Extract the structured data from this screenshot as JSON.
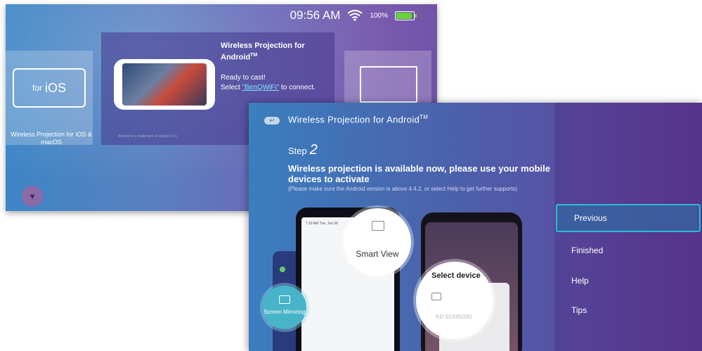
{
  "back_screen": {
    "status": {
      "time": "09:56 AM",
      "battery": "100%"
    },
    "ios_card": {
      "box_for": "for",
      "box_ios": "iOS",
      "label": "Wireless Projection for iOS & macOS"
    },
    "android_card": {
      "title": "Wireless Projection for Android",
      "tm": "TM",
      "ready": "Ready to cast!",
      "select_prefix": "Select ",
      "network": "\"BenQWiFi\"",
      "select_suffix": " to connect.",
      "trademark": "Android is a trademark of Google LLC."
    }
  },
  "front_screen": {
    "title": "Wireless Projection for Android",
    "tm": "TM",
    "step_label": "Step",
    "step_number": "2",
    "description": "Wireless projection is available now, please use your mobile devices to activate",
    "note": "(Please make sure the Android version is above 4.4.2, or select Help to get further supports)",
    "left_phone_clock": "7:18 AM   Tue, Jun 06",
    "smart_view": "Smart View",
    "screen_mirroring": "Screen Mirroring",
    "select_device": "Select device",
    "device_name": "KD-55X8500D"
  },
  "menu": {
    "items": [
      {
        "label": "Previous",
        "active": true
      },
      {
        "label": "Finished",
        "active": false
      },
      {
        "label": "Help",
        "active": false
      },
      {
        "label": "Tips",
        "active": false
      }
    ]
  },
  "colors": {
    "accent": "#2fb8d6",
    "battery": "#67d33a",
    "link": "#7de6ff"
  },
  "icons": [
    "wifi-icon",
    "battery-icon",
    "back-icon",
    "heart-icon",
    "cast-icon",
    "monitor-icon"
  ]
}
